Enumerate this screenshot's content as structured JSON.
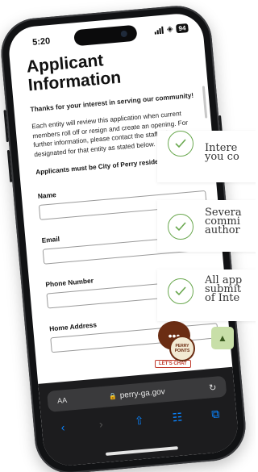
{
  "status_bar": {
    "time": "5:20",
    "battery": "94"
  },
  "page": {
    "title": "Applicant Information",
    "intro": "Thanks for your interest in serving our community!",
    "body": "Each entity will review this application when current members roll off or resign and create an opening. For further information, please contact the staff liaison designated for that entity as stated below.",
    "requirement": "Applicants must be City of Perry residents",
    "fields": [
      {
        "label": "Name",
        "value": ""
      },
      {
        "label": "Email",
        "value": ""
      },
      {
        "label": "Phone Number",
        "value": ""
      },
      {
        "label": "Home Address",
        "value": ""
      }
    ]
  },
  "chat_widget": {
    "badge": "PERRY POINTS",
    "label": "LET'S CHAT"
  },
  "browser": {
    "text_size": "AA",
    "url": "perry-ga.gov"
  },
  "cards": [
    {
      "text": "Intere\nyou co"
    },
    {
      "text": "Severa\ncommi\nauthor"
    },
    {
      "text": "All app\nsubmit\nof Inte"
    }
  ],
  "colors": {
    "check_green": "#6aa84f",
    "chat_brown": "#6b2d13",
    "link_blue": "#0a84ff"
  },
  "icons": [
    "signal-icon",
    "wifi-icon",
    "lock-icon",
    "reload-icon",
    "back-icon",
    "forward-icon",
    "share-icon",
    "bookmarks-icon",
    "tabs-icon",
    "chevron-up-icon",
    "chat-icon",
    "checkmark-icon"
  ]
}
